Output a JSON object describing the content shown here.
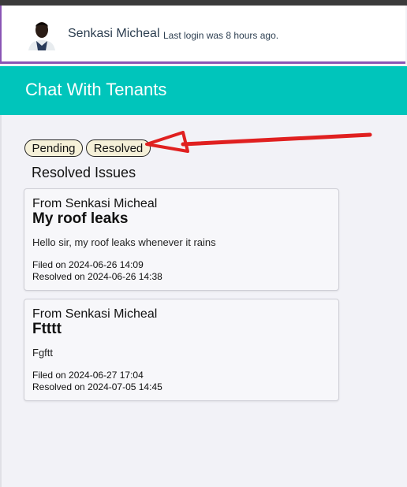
{
  "user": {
    "name": "Senkasi Micheal",
    "last_login": "Last login was 8 hours ago."
  },
  "header": {
    "title": "Chat With Tenants"
  },
  "tabs": [
    {
      "label": "Pending"
    },
    {
      "label": "Resolved"
    }
  ],
  "section": {
    "title": "Resolved Issues"
  },
  "issues": [
    {
      "from": "From Senkasi Micheal",
      "subject": "My roof leaks",
      "message": "Hello sir, my roof leaks whenever it rains",
      "filed": "Filed on 2024-06-26 14:09",
      "resolved": "Resolved on 2024-06-26 14:38"
    },
    {
      "from": "From Senkasi Micheal",
      "subject": "Ftttt",
      "message": "Fgftt",
      "filed": "Filed on 2024-06-27 17:04",
      "resolved": "Resolved on 2024-07-05 14:45"
    }
  ],
  "colors": {
    "header_bg": "#00c5bb",
    "accent_border": "#8a55b5",
    "annotation_arrow": "#e02020"
  }
}
